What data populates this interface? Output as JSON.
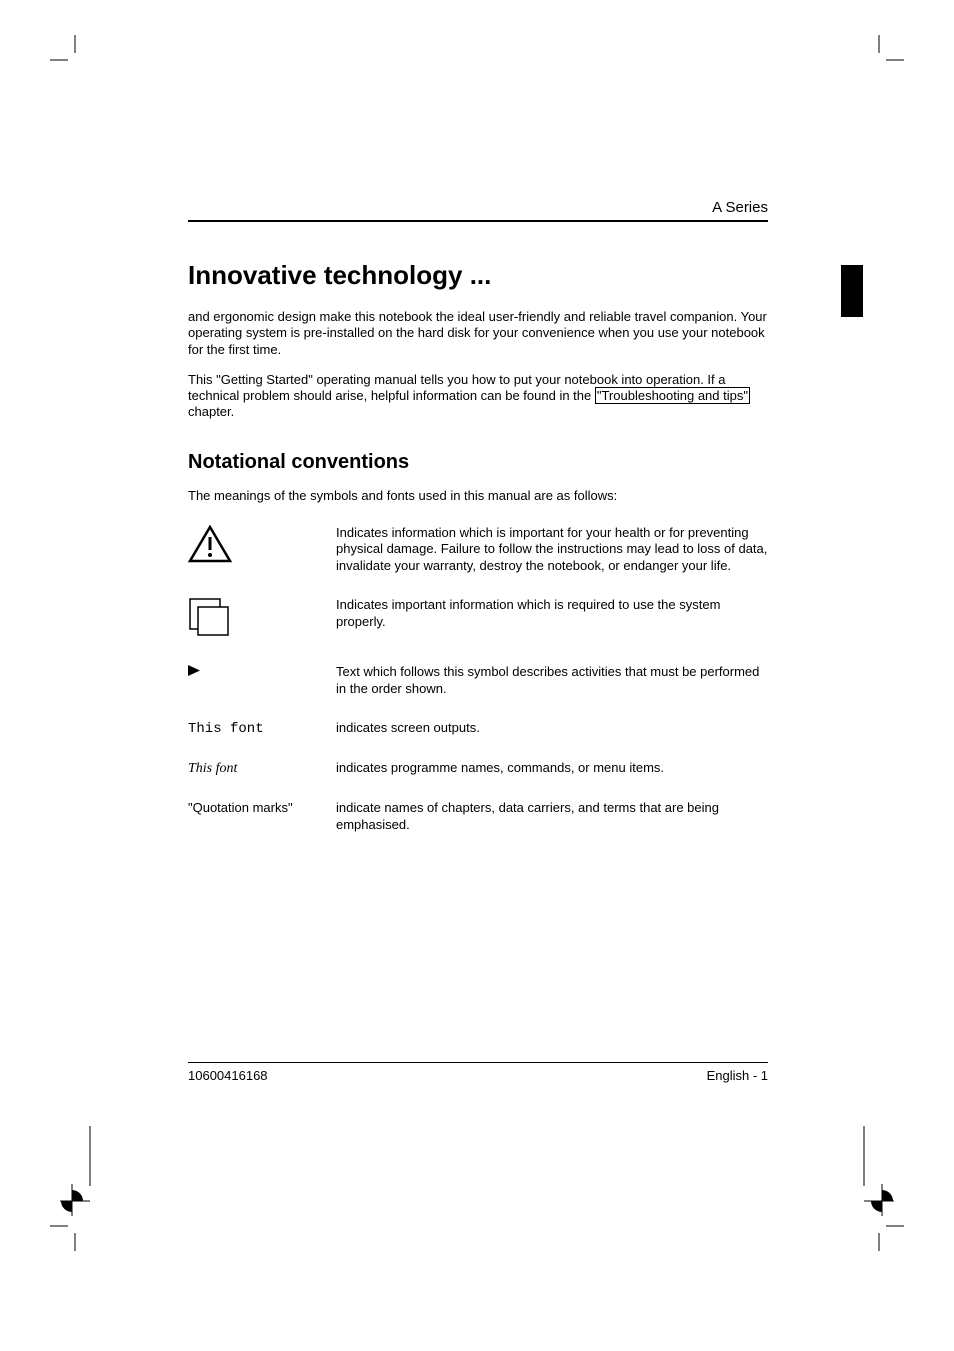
{
  "header": {
    "title": "A Series"
  },
  "main": {
    "heading": "Innovative technology ...",
    "para1": "and ergonomic design make this notebook the ideal user-friendly and reliable travel companion. Your operating system is pre-installed on the hard disk for your convenience when you use your notebook for the first time.",
    "para2_a": "This \"Getting Started\" operating manual tells you how to put your notebook into operation. If a technical problem should arise, helpful information can be found in the ",
    "para2_link": "\"Troubleshooting and tips\"",
    "para2_b": " chapter."
  },
  "section": {
    "heading": "Notational conventions",
    "intro": "The meanings of the symbols and fonts used in this manual are as follows:"
  },
  "conventions": [
    {
      "left_type": "warning-icon",
      "left_text": "",
      "right": "Indicates information which is important for your health or for preventing physical damage. Failure to follow the instructions may lead to loss of data, invalidate your warranty, destroy the notebook, or endanger your life."
    },
    {
      "left_type": "info-icon",
      "left_text": "",
      "right": "Indicates important information which is required to use the system properly."
    },
    {
      "left_type": "arrow-icon",
      "left_text": "",
      "right": "Text which follows this symbol describes activities that must be performed in the order shown."
    },
    {
      "left_type": "mono",
      "left_text": "This font",
      "right": "indicates screen outputs."
    },
    {
      "left_type": "italic",
      "left_text": "This font",
      "right": "indicates programme names, commands, or menu items."
    },
    {
      "left_type": "quote",
      "left_text": "\"Quotation marks\"",
      "right": "indicate names of chapters, data carriers, and terms that are being emphasised."
    }
  ],
  "footer": {
    "left": "10600416168",
    "right": "English - 1"
  }
}
